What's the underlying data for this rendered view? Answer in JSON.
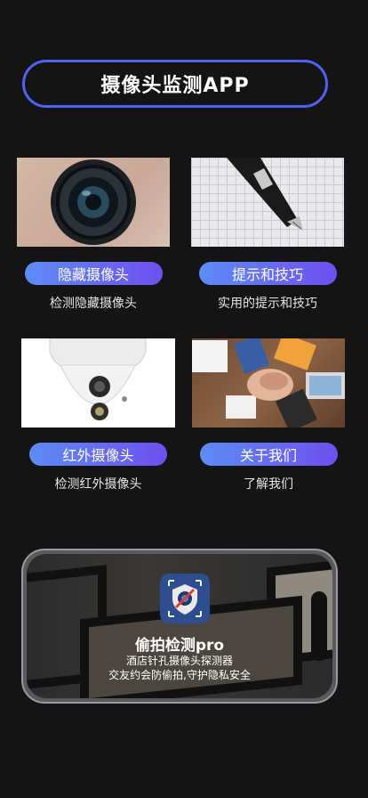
{
  "header": {
    "title": "摄像头监测APP"
  },
  "cards": [
    {
      "button": "隐藏摄像头",
      "desc": "检测隐藏摄像头"
    },
    {
      "button": "提示和技巧",
      "desc": "实用的提示和技巧"
    },
    {
      "button": "红外摄像头",
      "desc": "检测红外摄像头"
    },
    {
      "button": "关于我们",
      "desc": "了解我们"
    }
  ],
  "promo": {
    "app_name": "偷拍检测pro",
    "desc_line1": "酒店针孔摄像头探测器",
    "desc_line2": "交友约会防偷拍,守护隐私安全",
    "icon": "shield-camera-icon"
  },
  "colors": {
    "accent_border": "#4e63ef",
    "button_start": "#5d8cf5",
    "button_end": "#6f4ff0",
    "background": "#141414"
  }
}
